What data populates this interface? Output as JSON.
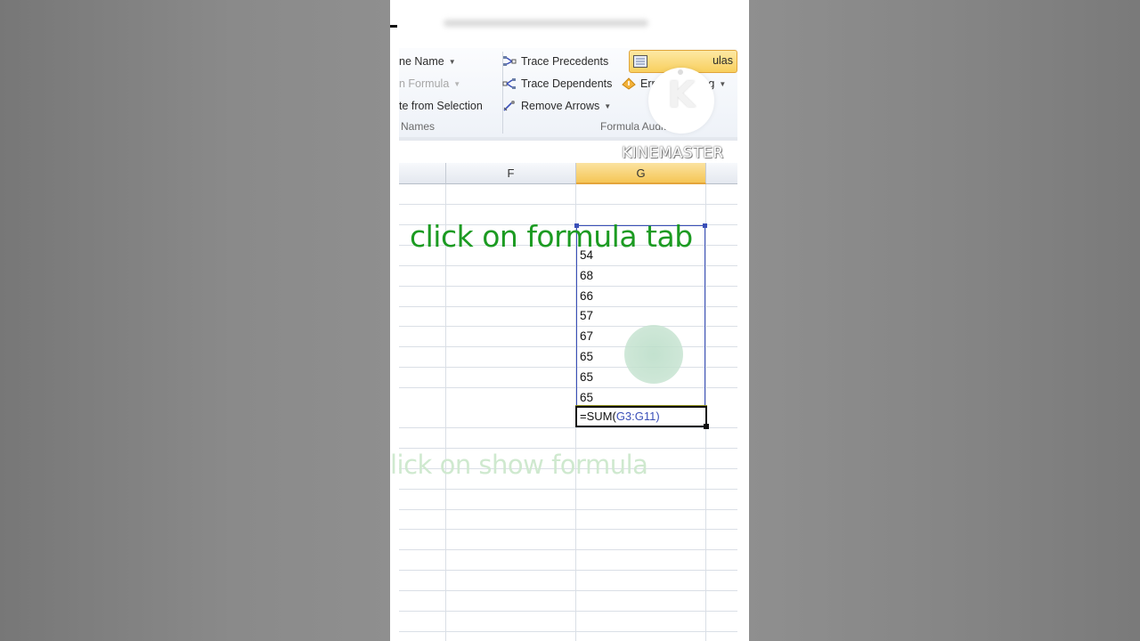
{
  "ribbon": {
    "names_group": {
      "items": [
        {
          "label": "ne Name",
          "has_caret": true,
          "dim": false
        },
        {
          "label": "n Formula",
          "has_caret": true,
          "dim": true
        },
        {
          "label": "te from Selection",
          "has_caret": false,
          "dim": false
        }
      ],
      "group_label": "Names"
    },
    "formula_auditing": {
      "items": [
        {
          "label": "Trace Precedents",
          "icon": "trace-precedents-icon"
        },
        {
          "label": "Trace Dependents",
          "icon": "trace-dependents-icon"
        },
        {
          "label": "Remove Arrows",
          "icon": "remove-arrows-icon",
          "has_caret": true
        }
      ],
      "show_formulas_label": "ulas",
      "error_checking_label": "Error Checking",
      "group_label": "Formula Auditing"
    },
    "accent_color": "#f8cf5e"
  },
  "watermark": {
    "logo_letter": "K",
    "text": "KINEMASTER"
  },
  "sheet": {
    "columns": [
      {
        "letter": "",
        "active": false
      },
      {
        "letter": "F",
        "active": false
      },
      {
        "letter": "G",
        "active": true
      }
    ],
    "g_values": [
      "54",
      "68",
      "66",
      "57",
      "67",
      "65",
      "65",
      "65"
    ],
    "active_cell_formula_prefix": "=SUM(",
    "active_cell_formula_ref": "G3:G11",
    "active_cell_formula_suffix": ")",
    "selection_color": "#3a4fb8"
  },
  "captions": {
    "main": "click on formula tab",
    "faded": "lick on show formula",
    "main_color": "#1c9b22"
  }
}
